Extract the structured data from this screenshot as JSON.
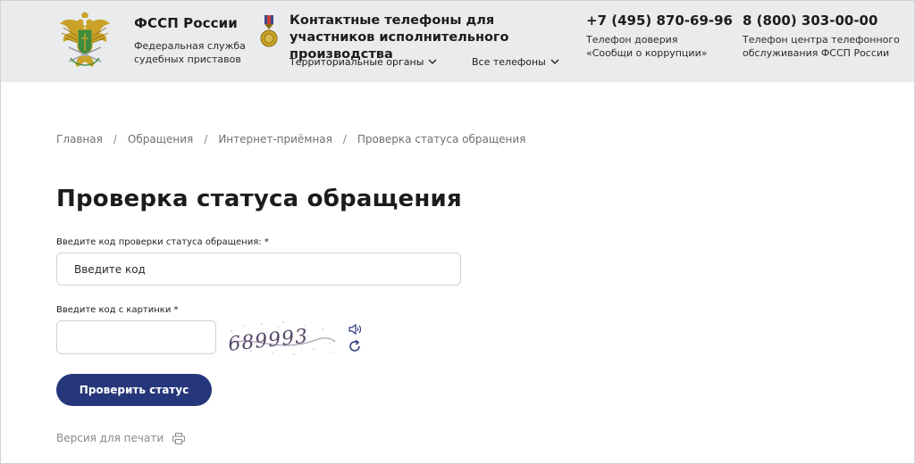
{
  "header": {
    "org_title": "ФССП России",
    "org_subtitle": "Федеральная служба судебных приставов",
    "contacts_title": "Контактные телефоны для участников исполнительного производства",
    "nav": [
      {
        "label": "Территориальные органы"
      },
      {
        "label": "Все телефоны"
      }
    ],
    "phones": [
      {
        "number": "+7 (495) 870-69-96",
        "caption": "Телефон доверия «Сообщи о коррупции»"
      },
      {
        "number": "8 (800) 303-00-00",
        "caption": "Телефон центра телефонного обслуживания ФССП России"
      }
    ]
  },
  "breadcrumb": {
    "items": [
      "Главная",
      "Обращения",
      "Интернет-приёмная",
      "Проверка статуса обращения"
    ],
    "separator": "/"
  },
  "page_title": "Проверка статуса обращения",
  "form": {
    "code_label": "Введите код проверки статуса обращения: *",
    "code_placeholder": "Введите код",
    "captcha_label": "Введите код с картинки *",
    "captcha_value": "",
    "captcha_image_text": "689993",
    "submit_label": "Проверить статус"
  },
  "print_label": "Версия для печати",
  "colors": {
    "header_bg": "#e9ebec",
    "button_bg": "#26367a",
    "text": "#1c1c1c",
    "muted": "#707070",
    "logo_gold": "#c9a227",
    "logo_green": "#3d8b3d"
  },
  "icons": {
    "logo": "fssp-eagle-emblem-icon",
    "medal": "medal-icon",
    "chevron": "chevron-down-icon",
    "sound": "speaker-icon",
    "refresh": "refresh-icon",
    "print": "printer-icon"
  }
}
